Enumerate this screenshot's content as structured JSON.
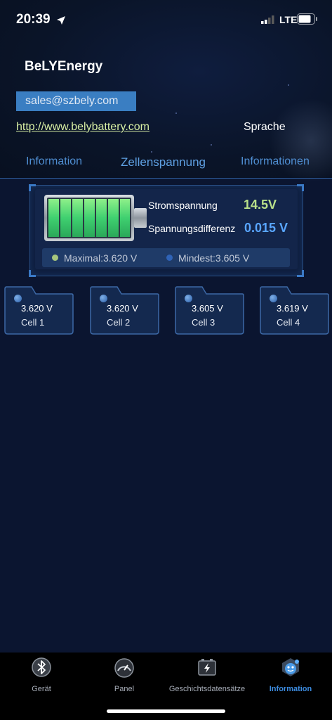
{
  "status_bar": {
    "time": "20:39",
    "network": "LTE"
  },
  "header": {
    "app_title": "BeLYEnergy",
    "email": "sales@szbely.com",
    "website": "http://www.belybattery.com",
    "language_label": "Sprache"
  },
  "tabs": [
    {
      "label": "Information",
      "active": false
    },
    {
      "label": "Zellenspannung",
      "active": true
    },
    {
      "label": "Informationen",
      "active": false
    }
  ],
  "summary": {
    "total_voltage_label": "Stromspannung",
    "total_voltage_value": "14.5V",
    "voltage_diff_label": "Spannungsdifferenz",
    "voltage_diff_value": "0.015 V",
    "max_text": "Maximal:3.620 V",
    "min_text": "Mindest:3.605 V"
  },
  "cells": [
    {
      "voltage": "3.620 V",
      "name": "Cell 1"
    },
    {
      "voltage": "3.620 V",
      "name": "Cell 2"
    },
    {
      "voltage": "3.605 V",
      "name": "Cell 3"
    },
    {
      "voltage": "3.619 V",
      "name": "Cell 4"
    }
  ],
  "bottom_nav": [
    {
      "label": "Gerät",
      "icon": "bluetooth-icon",
      "active": false
    },
    {
      "label": "Panel",
      "icon": "gauge-icon",
      "active": false
    },
    {
      "label": "Geschichtsdatensätze",
      "icon": "battery-history-icon",
      "active": false
    },
    {
      "label": "Information",
      "icon": "robot-icon",
      "active": true
    }
  ],
  "colors": {
    "background": "#0b1530",
    "accent_blue": "#59a6ff",
    "accent_green": "#b9e08a",
    "email_badge": "#3a7ec2",
    "link": "#d8efa4"
  }
}
